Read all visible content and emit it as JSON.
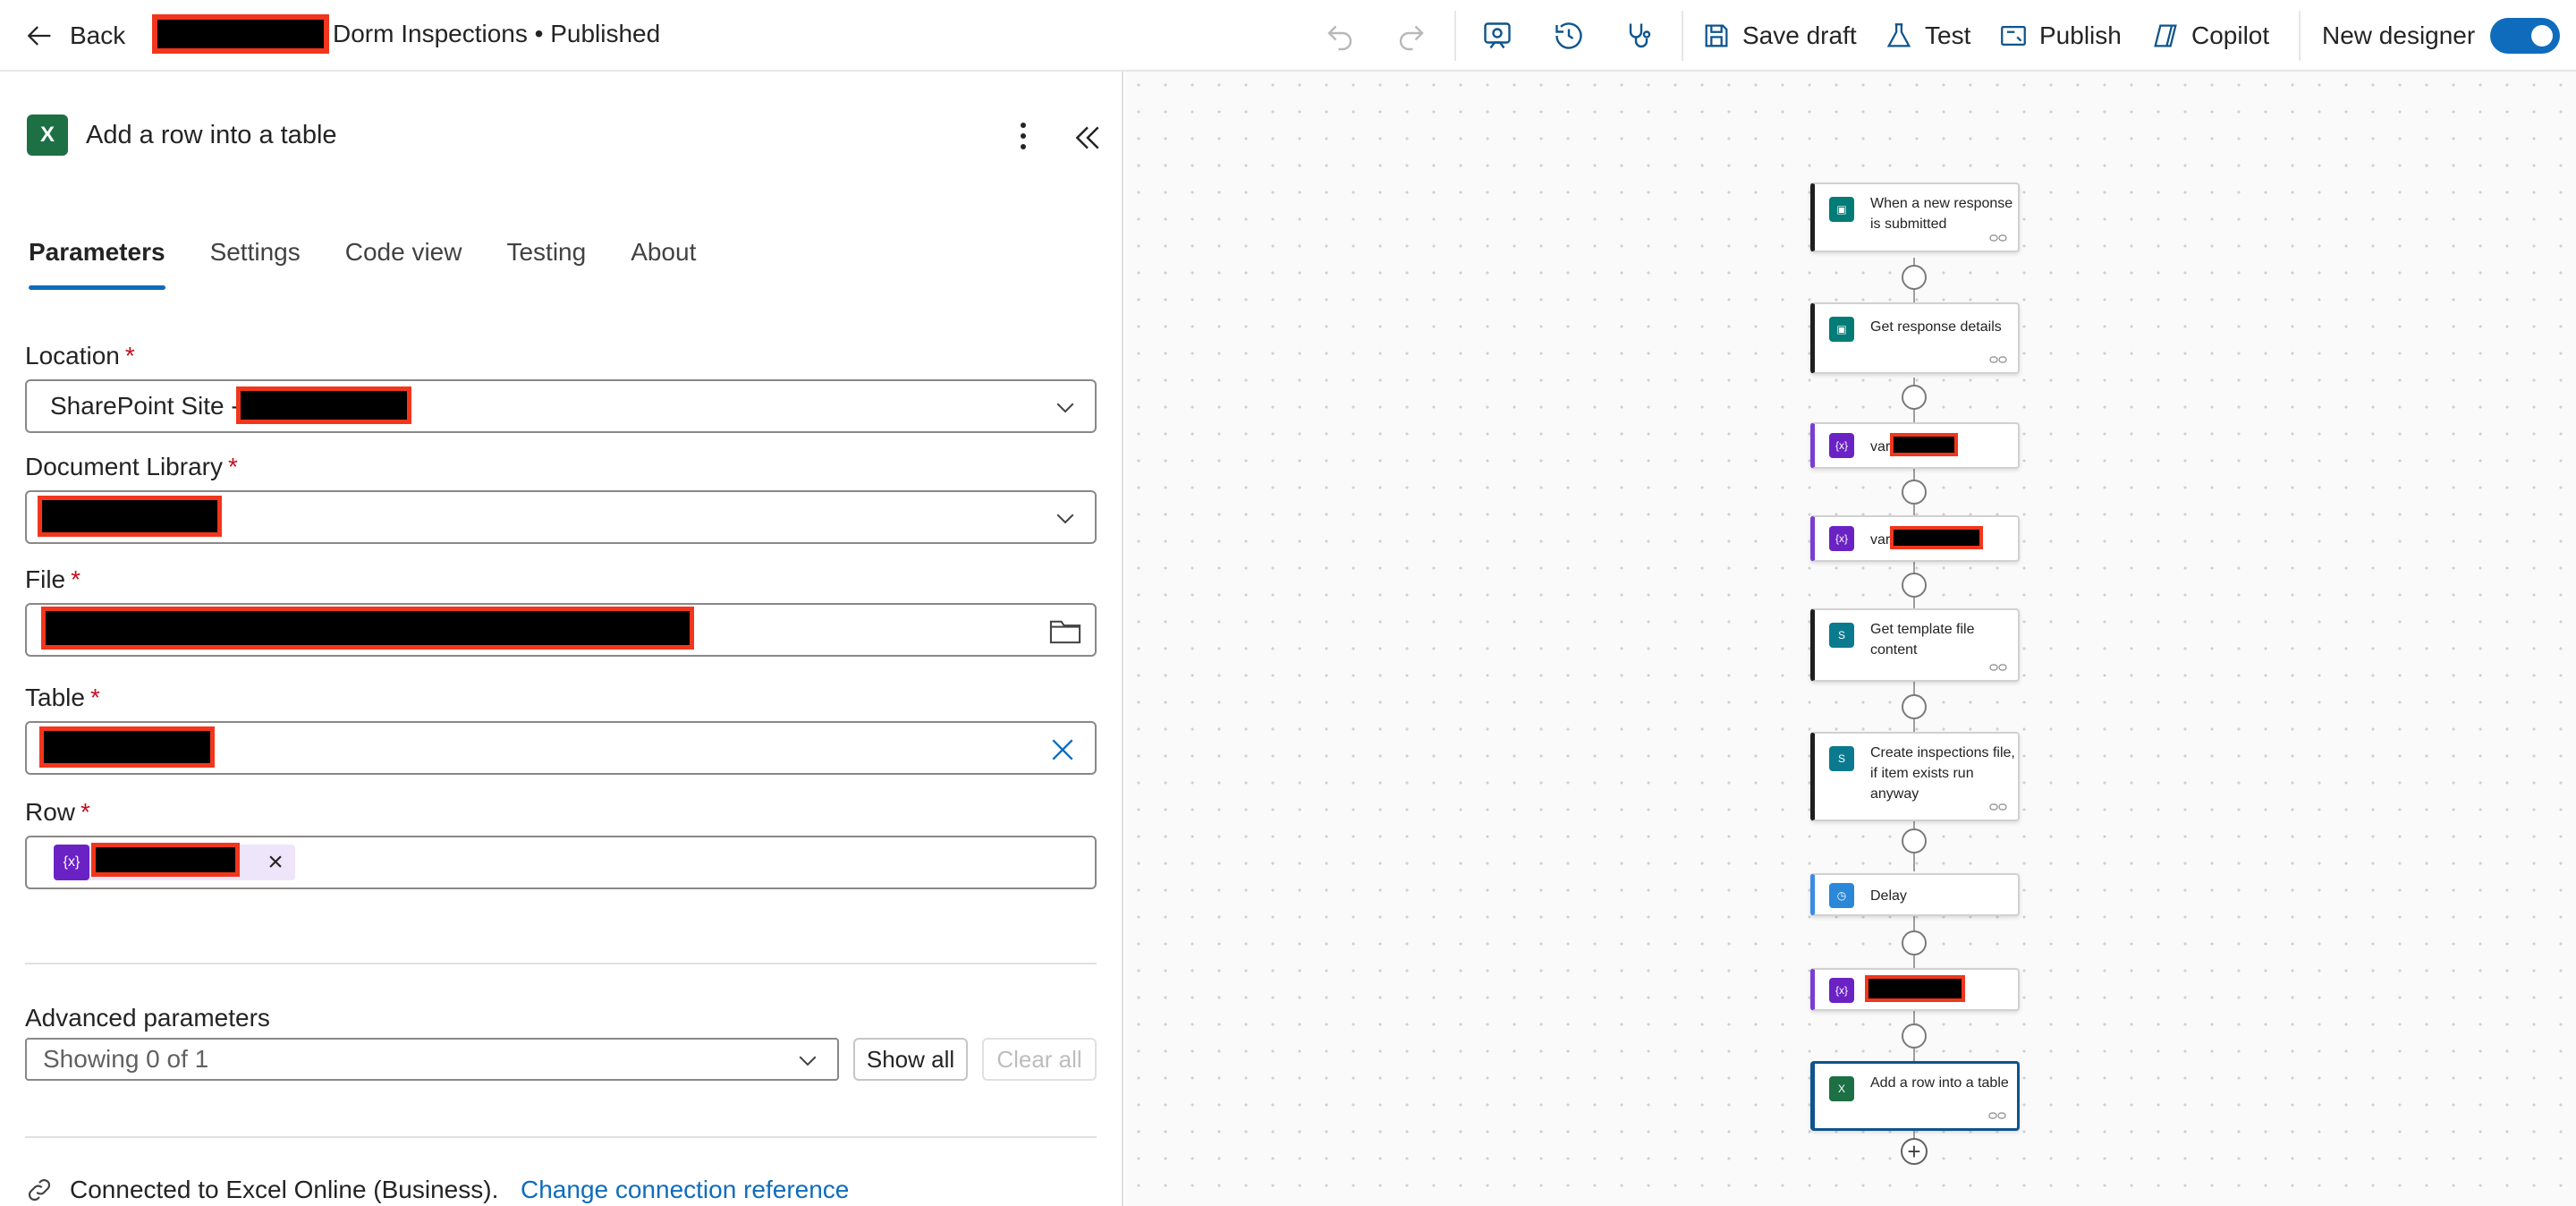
{
  "topbar": {
    "back_label": "Back",
    "title": "Dorm Inspections • Published",
    "save_draft_label": "Save draft",
    "test_label": "Test",
    "publish_label": "Publish",
    "copilot_label": "Copilot",
    "new_designer_label": "New designer",
    "new_designer_on": true
  },
  "panel": {
    "title": "Add a row into a table",
    "tabs": [
      "Parameters",
      "Settings",
      "Code view",
      "Testing",
      "About"
    ],
    "active_tab": "Parameters",
    "fields": {
      "location_label": "Location",
      "location_value": "SharePoint Site -",
      "library_label": "Document Library",
      "file_label": "File",
      "table_label": "Table",
      "row_label": "Row",
      "required_mark": "*"
    },
    "advanced": {
      "label": "Advanced parameters",
      "select_value": "Showing 0 of 1",
      "show_all_label": "Show all",
      "clear_all_label": "Clear all"
    },
    "connection_text": "Connected to Excel Online (Business).",
    "change_connection_label": "Change connection reference"
  },
  "flow": {
    "steps": [
      {
        "label": "When a new response is submitted",
        "icon": "forms-icon"
      },
      {
        "label": "Get response details",
        "icon": "forms-icon"
      },
      {
        "label": "var",
        "icon": "variable-icon"
      },
      {
        "label": "var",
        "icon": "variable-icon"
      },
      {
        "label": "Get template file content",
        "icon": "sharepoint-icon"
      },
      {
        "label": "Create inspections file, if item exists run anyway",
        "icon": "sharepoint-icon"
      },
      {
        "label": "Delay",
        "icon": "delay-icon"
      },
      {
        "label": "",
        "icon": "variable-icon"
      },
      {
        "label": "Add a row into a table",
        "icon": "excel-icon"
      }
    ],
    "var_icon_text": "{x}",
    "excel_icon_text": "X"
  },
  "colors": {
    "accent": "#0f6cbd",
    "redaction_border": "#f1361d",
    "variable_purple": "#6b22c5",
    "excel_green": "#1d7044"
  }
}
